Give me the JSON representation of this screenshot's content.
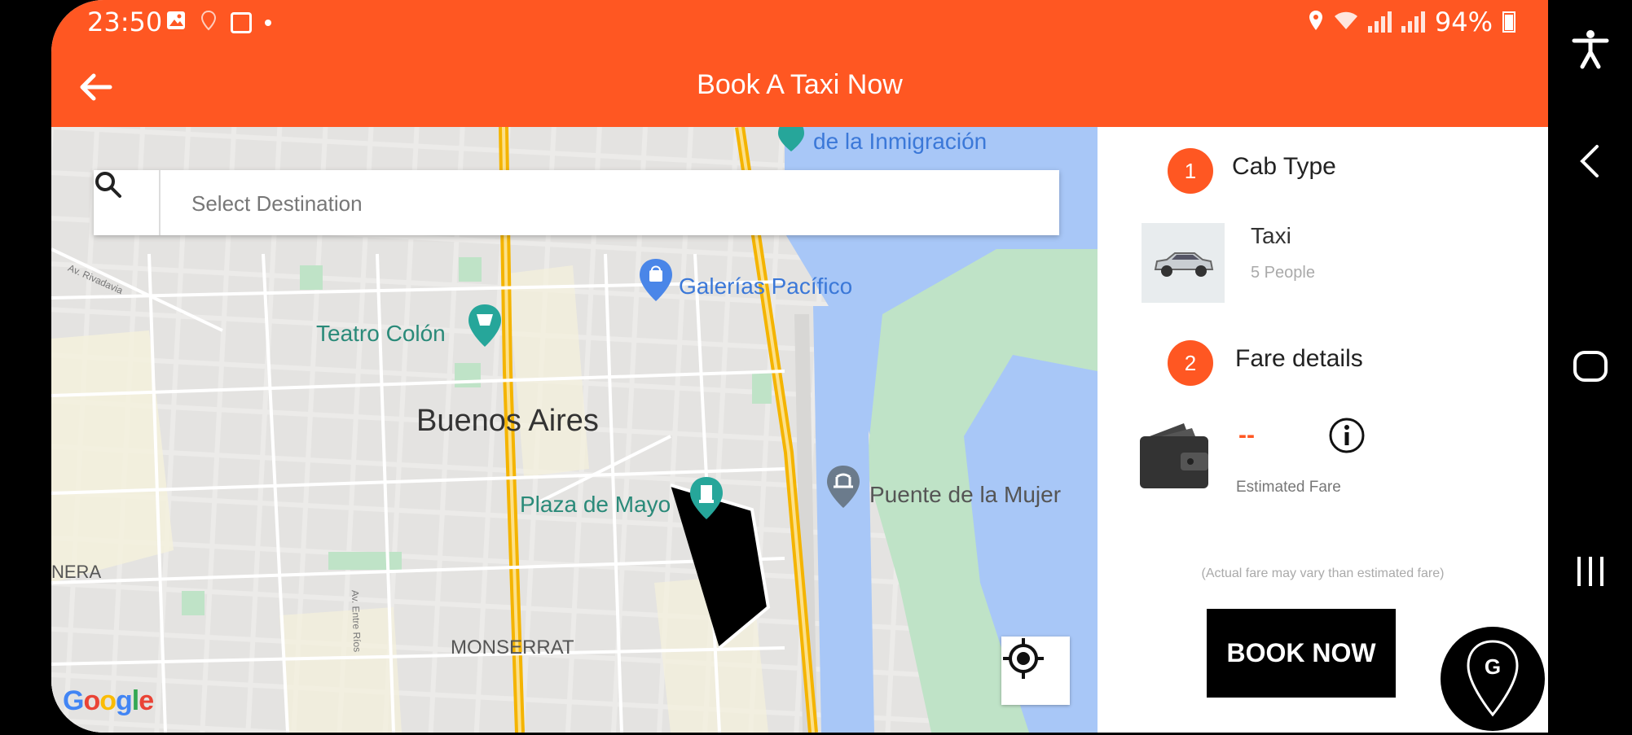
{
  "status_bar": {
    "time": "23:50",
    "battery": "94%",
    "icons": [
      "image-icon",
      "location-off-icon",
      "notification-app-icon",
      "dot-icon",
      "location-icon",
      "wifi-icon",
      "signal-icon",
      "signal-icon",
      "battery-icon"
    ]
  },
  "app_bar": {
    "title": "Book A Taxi Now",
    "back_icon": "back-arrow-icon"
  },
  "search": {
    "placeholder": "Select Destination",
    "icon": "search-icon"
  },
  "map": {
    "labels": {
      "immigration": "de la Inmigración",
      "galerias": "Galerías Pacífico",
      "teatro": "Teatro Colón",
      "buenos_aires": "Buenos Aires",
      "plaza": "Plaza de Mayo",
      "puente": "Puente de la Mujer",
      "nera": "NERA",
      "monserrat": "MONSERRAT",
      "rivadavia": "Av. Rivadavia",
      "entre_rios": "Av. Entre Ríos"
    },
    "google": [
      "G",
      "o",
      "o",
      "g",
      "l",
      "e"
    ],
    "colors": {
      "water": "#A8C7F7",
      "park": "#BFE3C7",
      "highway": "#F7C948",
      "accent": "#FF5722"
    }
  },
  "booking": {
    "step1": {
      "number": "1",
      "title": "Cab Type"
    },
    "cab": {
      "name": "Taxi",
      "capacity": "5 People",
      "icon": "car-icon"
    },
    "step2": {
      "number": "2",
      "title": "Fare details"
    },
    "fare": {
      "value": "--",
      "label": "Estimated Fare",
      "note": "(Actual fare may vary than estimated fare)"
    },
    "book_button": "BOOK NOW"
  },
  "fab": {
    "letter": "G"
  },
  "nav": {
    "icons": [
      "accessibility-icon",
      "back-icon",
      "home-icon",
      "recents-icon"
    ]
  }
}
